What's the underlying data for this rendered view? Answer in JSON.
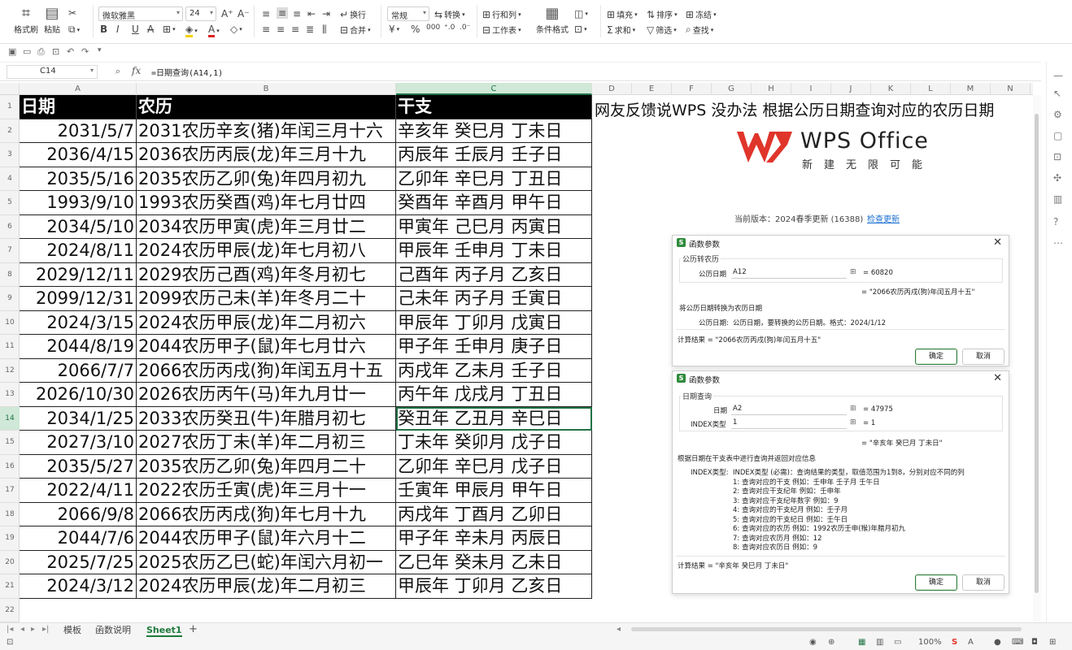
{
  "ribbon": {
    "format_painter": "格式刷",
    "paste": "粘贴",
    "cut_icon": "scissors-icon",
    "font_name": "微软雅黑",
    "font_size": "24",
    "wrap": "换行",
    "merge": "合并",
    "number_format": "常规",
    "convert": "转换",
    "row_col": "行和列",
    "worksheet": "工作表",
    "cond_format": "条件格式",
    "fill": "填充",
    "sort": "排序",
    "freeze": "冻结",
    "sum": "求和",
    "filter": "筛选",
    "find": "查找"
  },
  "formula_bar": {
    "cell_ref": "C14",
    "fx": "fx",
    "formula": "=日期查询(A14,1)"
  },
  "columns": [
    "A",
    "B",
    "C",
    "D",
    "E",
    "F",
    "G",
    "H",
    "I",
    "J",
    "K",
    "L",
    "M",
    "N"
  ],
  "row_numbers": [
    "1",
    "2",
    "3",
    "4",
    "5",
    "6",
    "7",
    "8",
    "9",
    "10",
    "11",
    "12",
    "13",
    "14",
    "15",
    "16",
    "17",
    "18",
    "19",
    "20",
    "21",
    "22"
  ],
  "table": {
    "headers": [
      "日期",
      "农历",
      "干支"
    ],
    "rows": [
      [
        "2031/5/7",
        "2031农历辛亥(猪)年闰三月十六",
        "辛亥年 癸巳月 丁未日"
      ],
      [
        "2036/4/15",
        "2036农历丙辰(龙)年三月十九",
        "丙辰年 壬辰月 壬子日"
      ],
      [
        "2035/5/16",
        "2035农历乙卯(兔)年四月初九",
        "乙卯年 辛巳月 丁丑日"
      ],
      [
        "1993/9/10",
        "1993农历癸酉(鸡)年七月廿四",
        "癸酉年 辛酉月 甲午日"
      ],
      [
        "2034/5/10",
        "2034农历甲寅(虎)年三月廿二",
        "甲寅年 己巳月 丙寅日"
      ],
      [
        "2024/8/11",
        "2024农历甲辰(龙)年七月初八",
        "甲辰年 壬申月 丁未日"
      ],
      [
        "2029/12/11",
        "2029农历己酉(鸡)年冬月初七",
        "己酉年 丙子月 乙亥日"
      ],
      [
        "2099/12/31",
        "2099农历己未(羊)年冬月二十",
        "己未年 丙子月 壬寅日"
      ],
      [
        "2024/3/15",
        "2024农历甲辰(龙)年二月初六",
        "甲辰年 丁卯月 戊寅日"
      ],
      [
        "2044/8/19",
        "2044农历甲子(鼠)年七月廿六",
        "甲子年 壬申月 庚子日"
      ],
      [
        "2066/7/7",
        "2066农历丙戌(狗)年闰五月十五",
        "丙戌年 乙未月 壬子日"
      ],
      [
        "2026/10/30",
        "2026农历丙午(马)年九月廿一",
        "丙午年 戊戌月 丁丑日"
      ],
      [
        "2034/1/25",
        "2033农历癸丑(牛)年腊月初七",
        "癸丑年 乙丑月 辛巳日"
      ],
      [
        "2027/3/10",
        "2027农历丁未(羊)年二月初三",
        "丁未年 癸卯月 戊子日"
      ],
      [
        "2035/5/27",
        "2035农历乙卯(兔)年四月二十",
        "乙卯年 辛巳月 戊子日"
      ],
      [
        "2022/4/11",
        "2022农历壬寅(虎)年三月十一",
        "壬寅年 甲辰月 甲午日"
      ],
      [
        "2066/9/8",
        "2066农历丙戌(狗)年七月十九",
        "丙戌年 丁酉月 乙卯日"
      ],
      [
        "2044/7/6",
        "2044农历甲子(鼠)年六月十二",
        "甲子年 辛未月 丙辰日"
      ],
      [
        "2025/7/25",
        "2025农历乙巳(蛇)年闰六月初一",
        "乙巳年 癸未月 乙未日"
      ],
      [
        "2024/3/12",
        "2024农历甲辰(龙)年二月初三",
        "甲辰年 丁卯月 乙亥日"
      ]
    ]
  },
  "headline": "网友反馈说WPS 没办法 根据公历日期查询对应的农历日期",
  "logo": {
    "name": "WPS Office",
    "tagline": "新建无限可能"
  },
  "version_text": "当前版本：2024春季更新 (16388)",
  "check_update": "检查更新",
  "dialog1": {
    "title": "函数参数",
    "group_title": "公历转农历",
    "param_label": "公历日期",
    "param_value": "A12",
    "param_result": "= 60820",
    "preview": "= \"2066农历丙戌(狗)年闰五月十五\"",
    "description": "将公历日期转换为农历日期",
    "param_help_label": "公历日期:",
    "param_help": "公历日期，要转换的公历日期。格式：2024/1/12",
    "calc_result": "计算结果 = \"2066农历丙戌(狗)年闰五月十五\"",
    "ok": "确定",
    "cancel": "取消"
  },
  "dialog2": {
    "title": "函数参数",
    "group_title": "日期查询",
    "param1_label": "日期",
    "param1_value": "A2",
    "param1_result": "= 47975",
    "param2_label": "INDEX类型",
    "param2_value": "1",
    "param2_result": "= 1",
    "preview": "= \"辛亥年 癸巳月 丁未日\"",
    "description": "根据日期在干支表中进行查询并返回对应信息",
    "help_label": "INDEX类型:",
    "help_lines": [
      "INDEX类型 (必需)：查询结果的类型，取值范围为1到8，分别对应不同的列",
      "1: 查询对应的干支 例如：壬申年 壬子月 壬午日",
      "2: 查询对应干支纪年 例如：壬申年",
      "3: 查询对应干支纪年数字 例如：9",
      "4: 查询对应的干支纪月 例如：壬子月",
      "5: 查询对应的干支纪日 例如：壬午日",
      "6: 查询对应的农历 例如：1992农历壬申(猴)年腊月初九",
      "7: 查询对应农历月 例如：12",
      "8: 查询对应农历日 例如：9"
    ],
    "calc_result": "计算结果 = \"辛亥年 癸巳月 丁未日\"",
    "ok": "确定",
    "cancel": "取消"
  },
  "sheet_tabs": [
    "模板",
    "函数说明",
    "Sheet1"
  ],
  "active_tab": "Sheet1",
  "status": {
    "zoom": "100%"
  },
  "colors": {
    "accent": "#217346",
    "header_bg": "#000000",
    "logo_red": "#e0352b"
  }
}
